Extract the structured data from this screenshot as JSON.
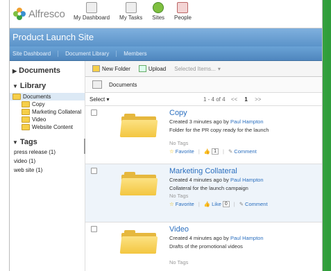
{
  "brand": {
    "logo_text": "Alfresco"
  },
  "topnav": [
    {
      "label": "My Dashboard"
    },
    {
      "label": "My Tasks"
    },
    {
      "label": "Sites"
    },
    {
      "label": "People"
    }
  ],
  "site": {
    "title": "Product Launch Site",
    "nav": [
      "Site Dashboard",
      "Document Library",
      "Members"
    ]
  },
  "sidebar": {
    "documents_label": "Documents",
    "library_label": "Library",
    "tree_root": "Documents",
    "tree_children": [
      "Copy",
      "Marketing Collateral",
      "Video",
      "Website Content"
    ],
    "tags_label": "Tags",
    "tags": [
      "press release (1)",
      "video (1)",
      "web site (1)"
    ]
  },
  "toolbar": {
    "new_folder": "New Folder",
    "upload": "Upload",
    "selected_items": "Selected Items..."
  },
  "crumb": {
    "path": "Documents"
  },
  "list": {
    "select_label": "Select",
    "pager_range": "1 - 4 of 4",
    "prev": "<<",
    "page": "1",
    "next": ">>"
  },
  "items": [
    {
      "name": "Copy",
      "created": "Created 3 minutes ago by",
      "author": "Paul Hampton",
      "desc": "Folder for the PR copy ready for the launch",
      "tags": "No Tags",
      "favorite": "Favorite",
      "like_count": "1",
      "comment": "Comment"
    },
    {
      "name": "Marketing Collateral",
      "created": "Created 4 minutes ago by",
      "author": "Paul Hampton",
      "desc": "Collateral for the launch campaign",
      "tags": "No Tags",
      "favorite": "Favorite",
      "like_label": "Like",
      "like_count": "0",
      "comment": "Comment"
    },
    {
      "name": "Video",
      "created": "Created 4 minutes ago by",
      "author": "Paul Hampton",
      "desc": "Drafts of the promotional videos",
      "tags": "No Tags"
    }
  ],
  "colors": {
    "accent_blue": "#5b93c9",
    "link": "#2b6fbf",
    "folder": "#f3c640"
  }
}
